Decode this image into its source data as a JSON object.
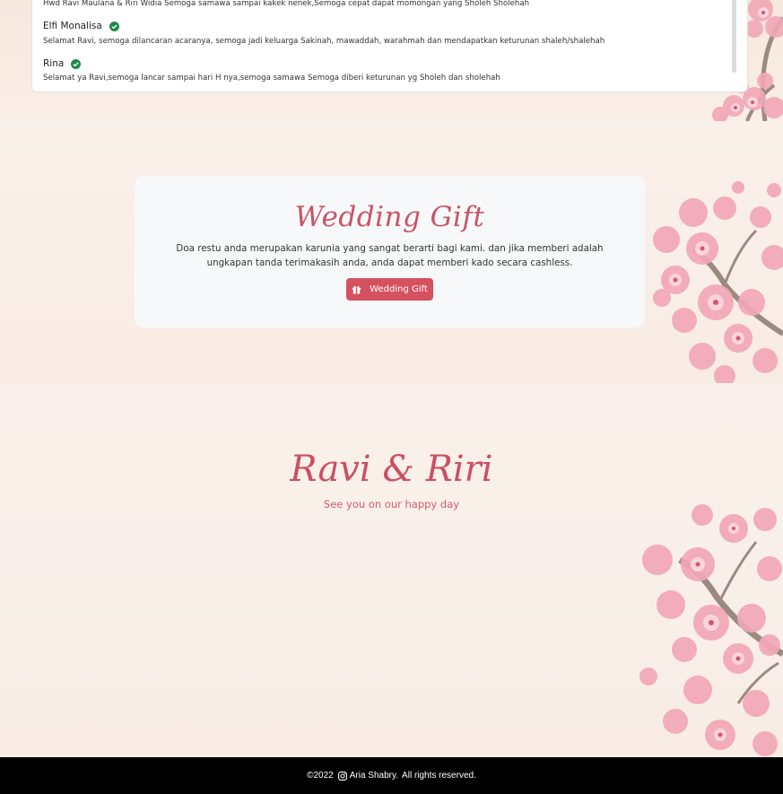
{
  "wishes": {
    "items": [
      {
        "name": "",
        "message": "Hwd Ravi Maulana & Riri Widia Semoga samawa sampai kakek nenek,Semoga cepat dapat momongan yang Sholeh Sholehah"
      },
      {
        "name": "Elfi Monalisa",
        "message": "Selamat Ravi, semoga dilancaran acaranya, semoga jadi keluarga Sakinah, mawaddah, warahmah dan mendapatkan keturunan shaleh/shalehah"
      },
      {
        "name": "Rina",
        "message": "Selamat ya Ravi,semoga lancar sampai hari H nya,semoga samawa Semoga diberi keturunan yg Sholeh dan sholehah"
      }
    ],
    "verified_icon": "check-circle-icon",
    "verified_color": "#1f8a4c"
  },
  "gift": {
    "title": "Wedding Gift",
    "description": "Doa restu anda merupakan karunia yang sangat berarti bagi kami. dan jika memberi adalah ungkapan tanda terimakasih anda, anda dapat memberi kado secara cashless.",
    "button_label": "Wedding Gift",
    "button_icon": "gift-icon",
    "accent": "#d5515f"
  },
  "closing": {
    "couple": "Ravi & Riri",
    "tagline": "See you on our happy day"
  },
  "footer": {
    "prefix": "©2022",
    "author": "Aria Shabry.",
    "suffix": "All rights reserved.",
    "icon": "instagram-icon"
  }
}
